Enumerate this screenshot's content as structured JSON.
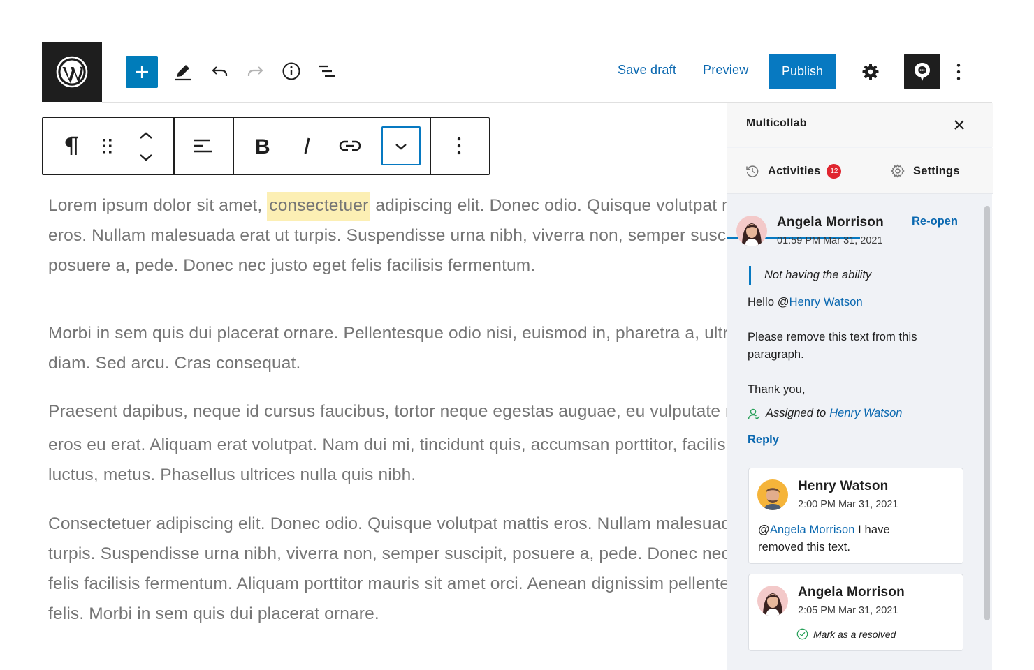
{
  "topbar": {
    "save_draft": "Save draft",
    "preview": "Preview",
    "publish": "Publish",
    "icons": [
      "wordpress-logo-icon",
      "plus-icon",
      "pen-icon",
      "undo-icon",
      "redo-icon",
      "info-icon",
      "list-view-icon",
      "gear-icon",
      "multicollab-icon",
      "more-vertical-icon"
    ]
  },
  "block_toolbar": {
    "icons": [
      "paragraph-icon",
      "drag-handle-icon",
      "move-up-down-icon",
      "align-left-icon",
      "bold-icon",
      "italic-icon",
      "link-icon",
      "chevron-down-icon",
      "more-vertical-icon"
    ]
  },
  "content": {
    "paragraphs": [
      {
        "lines": [
          {
            "before": "Lorem ipsum dolor sit amet, ",
            "highlight": "consectetuer",
            "after": " adipiscing elit. Donec odio. Quisque volutpat mattis"
          },
          {
            "text": "eros. Nullam malesuada erat ut turpis. Suspendisse urna nibh, viverra non, semper suscipit,"
          },
          {
            "text": "posuere a, pede. Donec nec justo eget felis facilisis fermentum."
          }
        ]
      },
      {
        "lines": [
          {
            "text": "Morbi in sem quis dui placerat ornare. Pellentesque odio nisi, euismod in, pharetra a, ultricies in,"
          },
          {
            "text": "diam. Sed arcu. Cras consequat."
          }
        ]
      },
      {
        "lines": [
          {
            "text": "Praesent dapibus, neque id cursus faucibus, tortor neque egestas auguae, eu vulputate magna"
          },
          {
            "text": "eros eu erat. Aliquam erat volutpat. Nam dui mi, tincidunt quis, accumsan porttitor, facilisis"
          },
          {
            "text": "luctus, metus. Phasellus ultrices nulla quis nibh."
          }
        ]
      },
      {
        "lines": [
          {
            "text": "Consectetuer adipiscing elit. Donec odio. Quisque volutpat mattis eros. Nullam malesuada erat ut"
          },
          {
            "text": "turpis. Suspendisse urna nibh, viverra non, semper suscipit, posuere a, pede. Donec nec justo eget"
          },
          {
            "text": "felis facilisis fermentum. Aliquam porttitor mauris sit amet orci. Aenean dignissim pellentesque"
          },
          {
            "text": "felis. Morbi in sem quis dui placerat ornare."
          }
        ]
      }
    ]
  },
  "sidebar": {
    "title": "Multicollab",
    "tabs": [
      {
        "label": "Activities",
        "badge": "12"
      },
      {
        "label": "Settings"
      }
    ],
    "thread": {
      "author": "Angela Morrison",
      "time": "01:59 PM Mar 31, 2021",
      "action": "Re-open",
      "quote": "Not having the ability",
      "greeting_prefix": "Hello @",
      "greeting_mention": "Henry Watson",
      "message_line1": "Please remove this text from this",
      "message_line2": "paragraph.",
      "signoff": "Thank you,",
      "assigned_label": "Assigned to",
      "assigned_to": "Henry Watson",
      "reply": "Reply"
    },
    "replies": [
      {
        "author": "Henry Watson",
        "time": "2:00 PM Mar 31, 2021",
        "mention_prefix": "@",
        "mention": "Angela Morrison",
        "text_after": " I have",
        "text_line2": "removed this text."
      },
      {
        "author": "Angela Morrison",
        "time": "2:05 PM Mar 31, 2021",
        "resolve": "Mark as a resolved"
      }
    ]
  },
  "colors": {
    "accent": "#0779c1",
    "link": "#0a68b0",
    "badge": "#e0252f",
    "highlight": "#fcefb4",
    "dark": "#1e1e1e"
  }
}
